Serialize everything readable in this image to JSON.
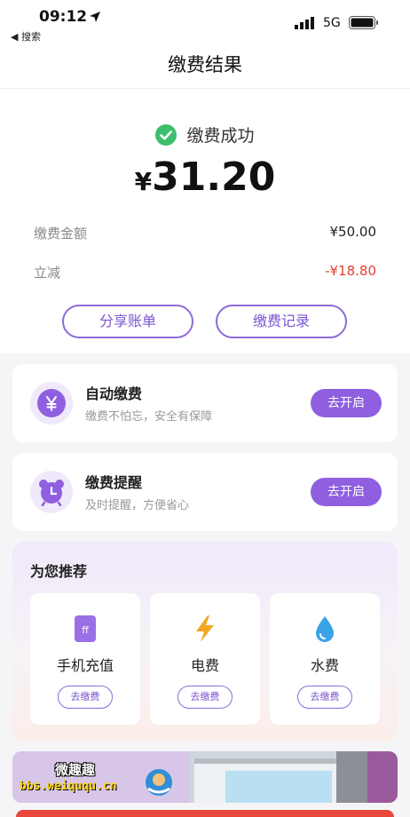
{
  "status_bar": {
    "time": "09:12",
    "back_label": "◀ 搜索",
    "network": "5G"
  },
  "nav": {
    "title": "缴费结果"
  },
  "result": {
    "status": "缴费成功",
    "currency": "¥",
    "amount": "31.20",
    "rows": [
      {
        "label": "缴费金额",
        "value": "¥50.00"
      },
      {
        "label": "立减",
        "value": "-¥18.80"
      }
    ],
    "share_label": "分享账单",
    "records_label": "缴费记录"
  },
  "features": [
    {
      "title": "自动缴费",
      "subtitle": "缴费不怕忘，安全有保障",
      "button": "去开启",
      "icon": "yen-icon"
    },
    {
      "title": "缴费提醒",
      "subtitle": "及时提醒，方便省心",
      "button": "去开启",
      "icon": "alarm-clock-icon"
    }
  ],
  "recommend": {
    "title": "为您推荐",
    "items": [
      {
        "label": "手机充值",
        "button": "去缴费",
        "icon": "phone-icon"
      },
      {
        "label": "电费",
        "button": "去缴费",
        "icon": "lightning-icon"
      },
      {
        "label": "水费",
        "button": "去缴费",
        "icon": "water-drop-icon"
      }
    ]
  },
  "watermark": {
    "top": "微趣趣",
    "bottom": "bbs.weiququ.cn"
  },
  "colors": {
    "accent": "#8f5fe0",
    "success": "#3cbf6b",
    "discount": "#e0402f"
  }
}
